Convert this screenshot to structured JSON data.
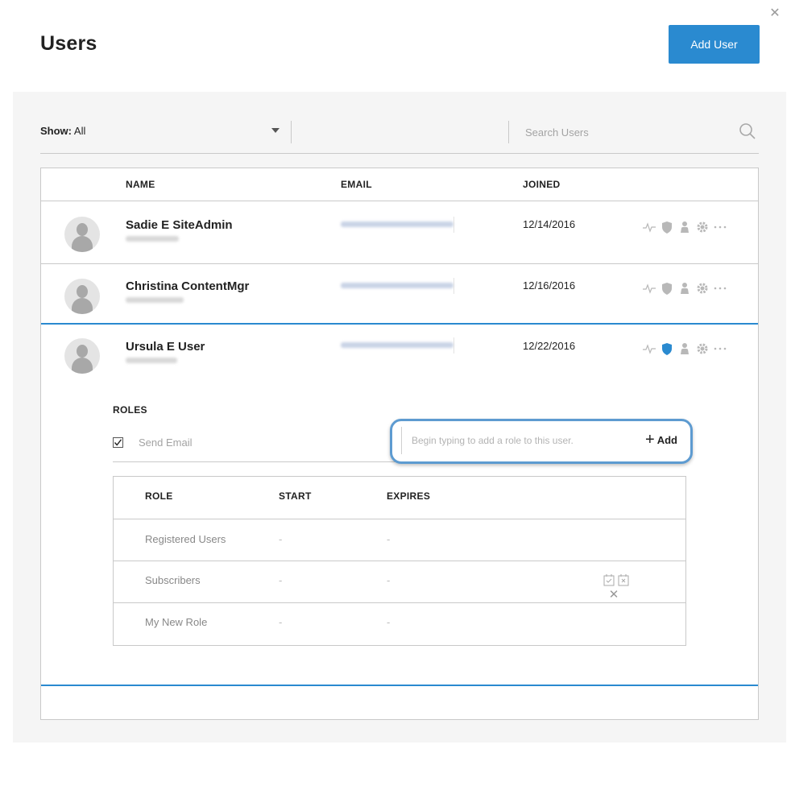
{
  "dialog": {
    "title": "Users",
    "add_user_label": "Add User",
    "close_icon": "close-icon"
  },
  "filter": {
    "show_key": "Show:",
    "show_value": "All",
    "search_placeholder": "Search Users"
  },
  "table": {
    "headers": {
      "name": "NAME",
      "email": "EMAIL",
      "joined": "JOINED"
    },
    "rows": [
      {
        "name": "Sadie E SiteAdmin",
        "joined": "12/14/2016",
        "admin_active": false
      },
      {
        "name": "Christina ContentMgr",
        "joined": "12/16/2016",
        "admin_active": false
      },
      {
        "name": "Ursula E User",
        "joined": "12/22/2016",
        "admin_active": true
      }
    ],
    "row_action_icons": [
      "activity-icon",
      "shield-icon",
      "person-icon",
      "gear-icon",
      "more-icon"
    ],
    "accent_color": "#2a8ad0"
  },
  "roles": {
    "title": "ROLES",
    "send_email_label": "Send Email",
    "send_email_checked": true,
    "input_placeholder": "Begin typing to add a role to this user.",
    "add_label": "Add",
    "headers": {
      "role": "ROLE",
      "start": "START",
      "expires": "EXPIRES"
    },
    "rows": [
      {
        "role": "Registered Users",
        "start": "-",
        "expires": "-"
      },
      {
        "role": "Subscribers",
        "start": "-",
        "expires": "-"
      },
      {
        "role": "My New Role",
        "start": "-",
        "expires": "-"
      }
    ],
    "row_action_icons": [
      "calendar-start-icon",
      "calendar-end-icon",
      "remove-icon"
    ]
  }
}
